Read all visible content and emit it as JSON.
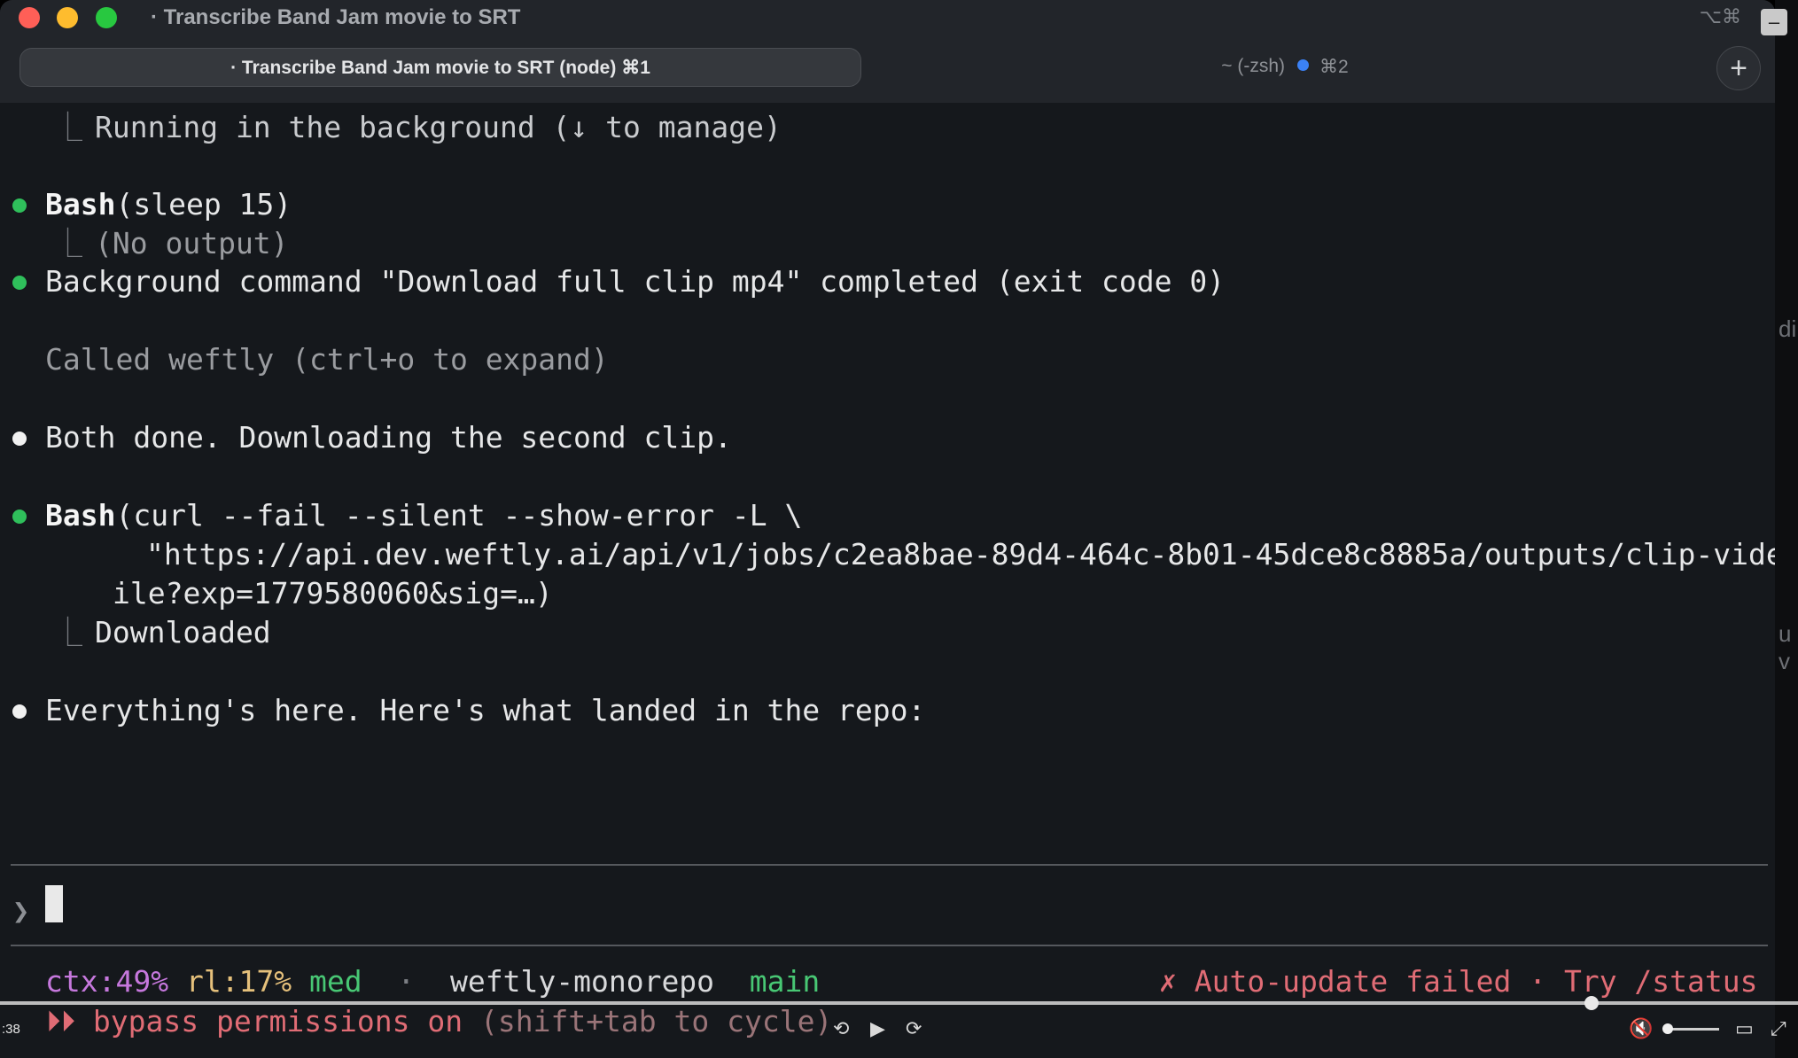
{
  "window": {
    "title": "· Transcribe Band Jam movie to SRT",
    "title_shortcut": "⌥⌘"
  },
  "tabs": {
    "active_label": "· Transcribe Band Jam movie to SRT (node) ⌘1",
    "inactive_label": "~ (-zsh)",
    "inactive_shortcut": "⌘2",
    "add_label": "+"
  },
  "terminal": {
    "line_running_corner": "⎿",
    "line_running": "Running in the background (↓ to manage)",
    "bash1_name": "Bash",
    "bash1_args": "(sleep 15)",
    "bash1_corner": "⎿",
    "bash1_output": "(No output)",
    "bg_complete": "Background command \"Download full clip mp4\" completed (exit code 0)",
    "called_weftly": "Called weftly (ctrl+o to expand)",
    "both_done": "Both done. Downloading the second clip.",
    "bash2_name": "Bash",
    "bash2_args": "(curl --fail --silent --show-error -L \\",
    "bash2_url_line1": "\"https://api.dev.weftly.ai/api/v1/jobs/c2ea8bae-89d4-464c-8b01-45dce8c8885a/outputs/clip-video/f",
    "bash2_url_line2": "ile?exp=1779580060&sig=…)",
    "bash2_corner": "⎿",
    "bash2_output": "Downloaded",
    "everything_here": "Everything's here. Here's what landed in the repo:",
    "prompt_symbol": "❯"
  },
  "statusline": {
    "ctx": "ctx:49%",
    "rl": "rl:17%",
    "effort": "med",
    "separator": "·",
    "repo": "weftly-monorepo",
    "branch": "main",
    "error": "✗ Auto-update failed · Try /status",
    "bypass_arrows": "⏵⏵",
    "bypass_text": "bypass permissions on",
    "bypass_hint": "(shift+tab to cycle)"
  },
  "player": {
    "timecode": ":38",
    "progress": 0.885
  },
  "side": {
    "text1": "dir",
    "text2": "u v"
  },
  "colors": {
    "bullet_green": "#2fbf5b",
    "ctx": "#c678dd",
    "rl": "#e5c07b",
    "branch": "#48c774",
    "error": "#e06c75"
  }
}
